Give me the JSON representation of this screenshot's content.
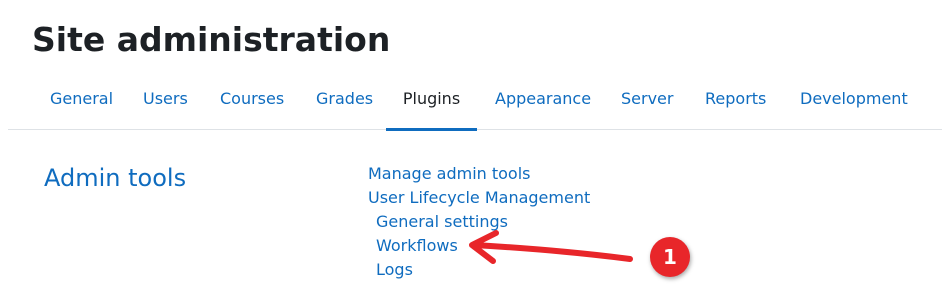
{
  "header": {
    "title": "Site administration"
  },
  "tabs": [
    {
      "label": "General"
    },
    {
      "label": "Users"
    },
    {
      "label": "Courses"
    },
    {
      "label": "Grades"
    },
    {
      "label": "Plugins",
      "active": true
    },
    {
      "label": "Appearance"
    },
    {
      "label": "Server"
    },
    {
      "label": "Reports"
    },
    {
      "label": "Development"
    }
  ],
  "section": {
    "heading": "Admin tools",
    "links": [
      {
        "label": "Manage admin tools"
      },
      {
        "label": "User Lifecycle Management"
      },
      {
        "label": "General settings"
      },
      {
        "label": "Workflows"
      },
      {
        "label": "Logs"
      }
    ]
  },
  "annotation": {
    "step_number": "1",
    "color": "#e8262a"
  },
  "colors": {
    "link": "#0f6cbf",
    "text": "#1d2125",
    "divider": "#dee2e6"
  }
}
